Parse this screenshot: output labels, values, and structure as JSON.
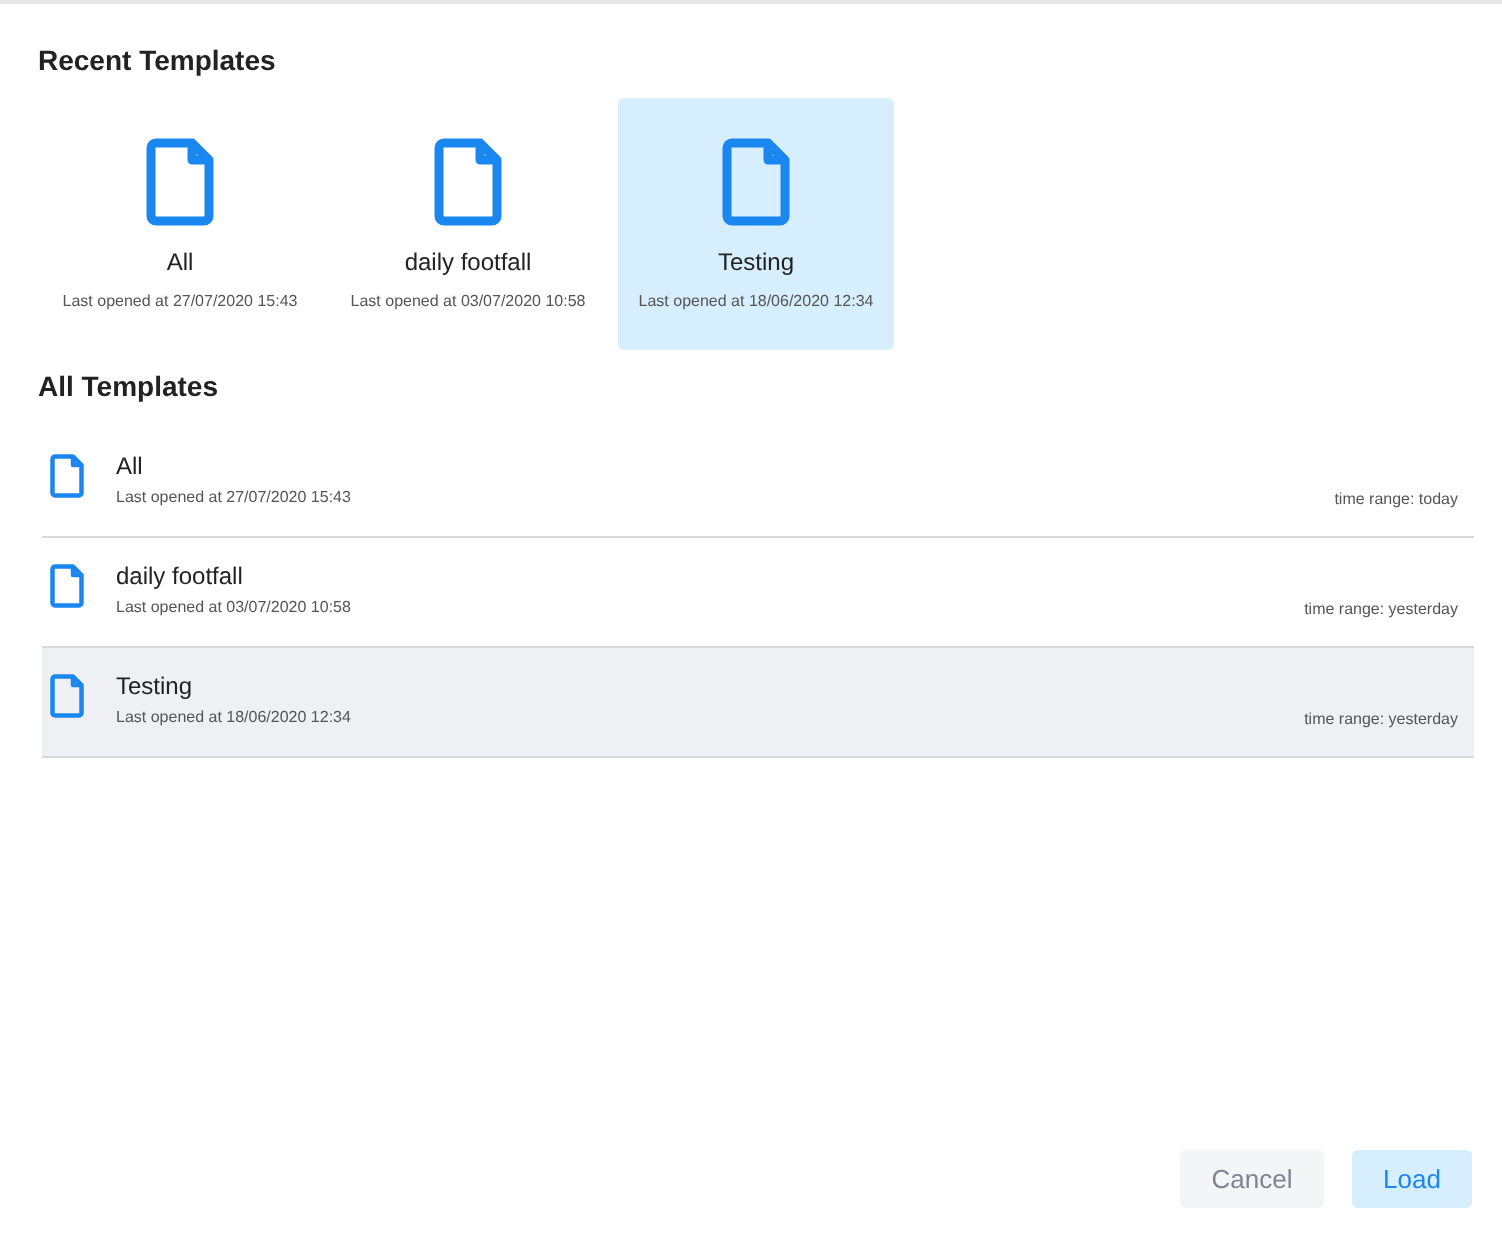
{
  "recent_templates": {
    "title": "Recent Templates",
    "items": [
      {
        "name": "All",
        "last_opened": "Last opened at 27/07/2020 15:43",
        "selected": false
      },
      {
        "name": "daily footfall",
        "last_opened": "Last opened at 03/07/2020 10:58",
        "selected": false
      },
      {
        "name": "Testing",
        "last_opened": "Last opened at 18/06/2020 12:34",
        "selected": true
      }
    ]
  },
  "all_templates": {
    "title": "All Templates",
    "rows": [
      {
        "name": "All",
        "last_opened": "Last opened at 27/07/2020 15:43",
        "time_range": "time range: today",
        "selected": false
      },
      {
        "name": "daily footfall",
        "last_opened": "Last opened at 03/07/2020 10:58",
        "time_range": "time range: yesterday",
        "selected": false
      },
      {
        "name": "Testing",
        "last_opened": "Last opened at 18/06/2020 12:34",
        "time_range": "time range: yesterday",
        "selected": true
      }
    ]
  },
  "buttons": [
    {
      "label": "Cancel",
      "kind": "secondary"
    },
    {
      "label": "Load",
      "kind": "primary"
    }
  ]
}
